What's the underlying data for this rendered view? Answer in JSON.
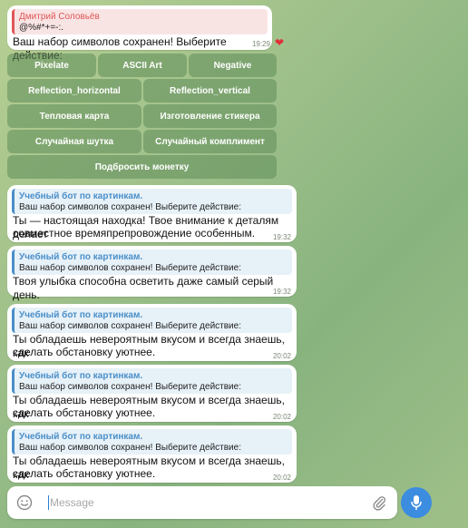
{
  "messages": [
    {
      "quote_name": "Дмитрий Соловьёв",
      "quote_text": "@%#*+=-:.",
      "text": "Ваш набор символов сохранен! Выберите действие:",
      "time": "19:29",
      "reaction": "❤"
    },
    {
      "quote_name": "Учебный бот по картинкам.",
      "quote_text": "Ваш набор символов сохранен! Выберите действие:",
      "text_line1": "Ты — настоящая находка! Твое внимание к деталям делает",
      "text_line2": "совместное времяпрепровождение особенным.",
      "time": "19:32"
    },
    {
      "quote_name": "Учебный бот по картинкам.",
      "quote_text": "Ваш набор символов сохранен! Выберите действие:",
      "text_line1": "Твоя улыбка способна осветить даже самый серый день.",
      "time": "19:32"
    },
    {
      "quote_name": "Учебный бот по картинкам.",
      "quote_text": "Ваш набор символов сохранен! Выберите действие:",
      "text_line1": "Ты обладаешь невероятным вкусом и всегда знаешь, как",
      "text_line2": "сделать обстановку уютнее.",
      "time": "20:02"
    },
    {
      "quote_name": "Учебный бот по картинкам.",
      "quote_text": "Ваш набор символов сохранен! Выберите действие:",
      "text_line1": "Ты обладаешь невероятным вкусом и всегда знаешь, как",
      "text_line2": "сделать обстановку уютнее.",
      "time": "20:02"
    },
    {
      "quote_name": "Учебный бот по картинкам.",
      "quote_text": "Ваш набор символов сохранен! Выберите действие:",
      "text_line1": "Ты обладаешь невероятным вкусом и всегда знаешь, как",
      "text_line2": "сделать обстановку уютнее.",
      "time": "20:02"
    }
  ],
  "keyboard": {
    "row1": [
      "Pixelate",
      "ASCII Art",
      "Negative"
    ],
    "row2": [
      "Reflection_horizontal",
      "Reflection_vertical"
    ],
    "row3": [
      "Тепловая карта",
      "Изготовление стикера"
    ],
    "row4": [
      "Случайная шутка",
      "Случайный комплимент"
    ],
    "row5": [
      "Подбросить монетку"
    ]
  },
  "composer": {
    "placeholder": "Message",
    "smile_icon": "smile-icon",
    "attach_icon": "paperclip-icon",
    "mic_icon": "microphone-icon"
  },
  "colors": {
    "accent": "#3c8ce0",
    "quote_bar": "#4a8fc9",
    "sender_red": "#e05757"
  }
}
